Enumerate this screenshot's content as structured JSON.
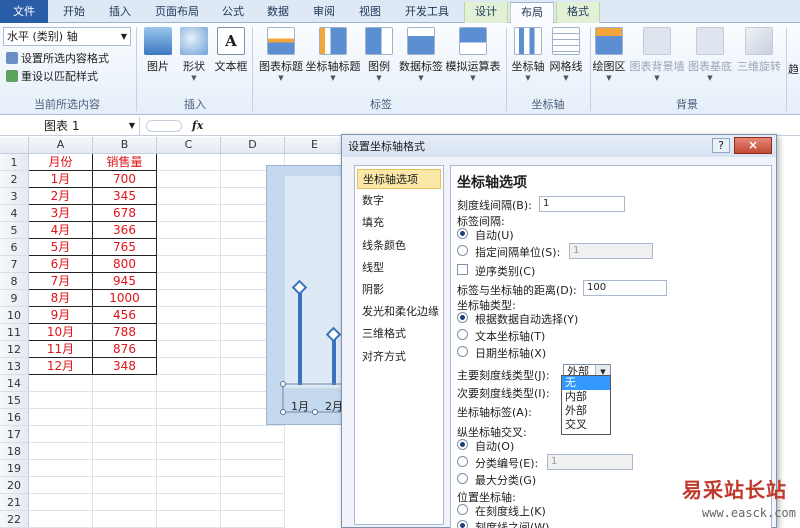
{
  "tabs": [
    {
      "label": "文件"
    },
    {
      "label": "开始"
    },
    {
      "label": "插入"
    },
    {
      "label": "页面布局"
    },
    {
      "label": "公式"
    },
    {
      "label": "数据"
    },
    {
      "label": "审阅"
    },
    {
      "label": "视图"
    },
    {
      "label": "开发工具"
    },
    {
      "label": "设计"
    },
    {
      "label": "布局"
    },
    {
      "label": "格式"
    }
  ],
  "ribbon": {
    "current_selection": {
      "dropdown_value": "水平 (类别) 轴",
      "format_selection": "设置所选内容格式",
      "reset_style": "重设以匹配样式",
      "group_label": "当前所选内容"
    },
    "insert": {
      "picture": "图片",
      "shapes": "形状",
      "textbox": "文本框",
      "group_label": "插入"
    },
    "labels": {
      "chart_title": "图表标题",
      "axis_titles": "坐标轴标题",
      "legend": "图例",
      "data_labels": "数据标签",
      "data_table": "模拟运算表",
      "group_label": "标签"
    },
    "axes": {
      "axes": "坐标轴",
      "gridlines": "网格线",
      "group_label": "坐标轴"
    },
    "background": {
      "plot_area": "绘图区",
      "chart_wall": "图表背景墙",
      "chart_floor": "图表基底",
      "rotation_3d": "三维旋转",
      "group_label": "背景"
    },
    "overflow": "趋"
  },
  "formula_bar": {
    "name_box": "图表 1",
    "fx": "fx"
  },
  "sheet": {
    "columns": [
      "A",
      "B",
      "C",
      "D",
      "E"
    ],
    "rows": [
      "1",
      "2",
      "3",
      "4",
      "5",
      "6",
      "7",
      "8",
      "9",
      "10",
      "11",
      "12",
      "13",
      "14",
      "15",
      "16",
      "17",
      "18",
      "19",
      "20",
      "21",
      "22"
    ],
    "header": [
      "月份",
      "销售量"
    ],
    "data": [
      [
        "1月",
        "700"
      ],
      [
        "2月",
        "345"
      ],
      [
        "3月",
        "678"
      ],
      [
        "4月",
        "366"
      ],
      [
        "5月",
        "765"
      ],
      [
        "6月",
        "800"
      ],
      [
        "7月",
        "945"
      ],
      [
        "8月",
        "1000"
      ],
      [
        "9月",
        "456"
      ],
      [
        "10月",
        "788"
      ],
      [
        "11月",
        "876"
      ],
      [
        "12月",
        "348"
      ]
    ]
  },
  "chart_labels": [
    "1月",
    "2月"
  ],
  "dialog": {
    "title": "设置坐标轴格式",
    "help": "?",
    "close": "×",
    "nav": [
      "坐标轴选项",
      "数字",
      "填充",
      "线条颜色",
      "线型",
      "阴影",
      "发光和柔化边缘",
      "三维格式",
      "对齐方式"
    ],
    "panel": {
      "heading": "坐标轴选项",
      "tick_interval_label": "刻度线间隔(B):",
      "tick_interval_value": "1",
      "label_interval_label": "标签间隔:",
      "auto": "自动(U)",
      "specify_unit": "指定间隔单位(S):",
      "specify_unit_value": "1",
      "reverse_order": "逆序类别(C)",
      "label_distance_label": "标签与坐标轴的距离(D):",
      "label_distance_value": "100",
      "axis_type_label": "坐标轴类型:",
      "axis_type_auto": "根据数据自动选择(Y)",
      "axis_type_text": "文本坐标轴(T)",
      "axis_type_date": "日期坐标轴(X)",
      "major_tick_label": "主要刻度线类型(J):",
      "major_tick_value": "外部",
      "minor_tick_label": "次要刻度线类型(I):",
      "axis_labels_label": "坐标轴标签(A):",
      "vertical_cross_label": "纵坐标轴交叉:",
      "cross_auto": "自动(O)",
      "cross_category": "分类编号(E):",
      "cross_category_value": "1",
      "cross_max": "最大分类(G)",
      "position_label": "位置坐标轴:",
      "on_tick": "在刻度线上(K)",
      "between_tick": "刻度线之间(W)"
    },
    "dropdown_options": [
      "无",
      "内部",
      "外部",
      "交叉"
    ],
    "dropdown_highlight": "无"
  },
  "watermark": {
    "brand": "易采站长站",
    "site": "www.easck.com"
  }
}
